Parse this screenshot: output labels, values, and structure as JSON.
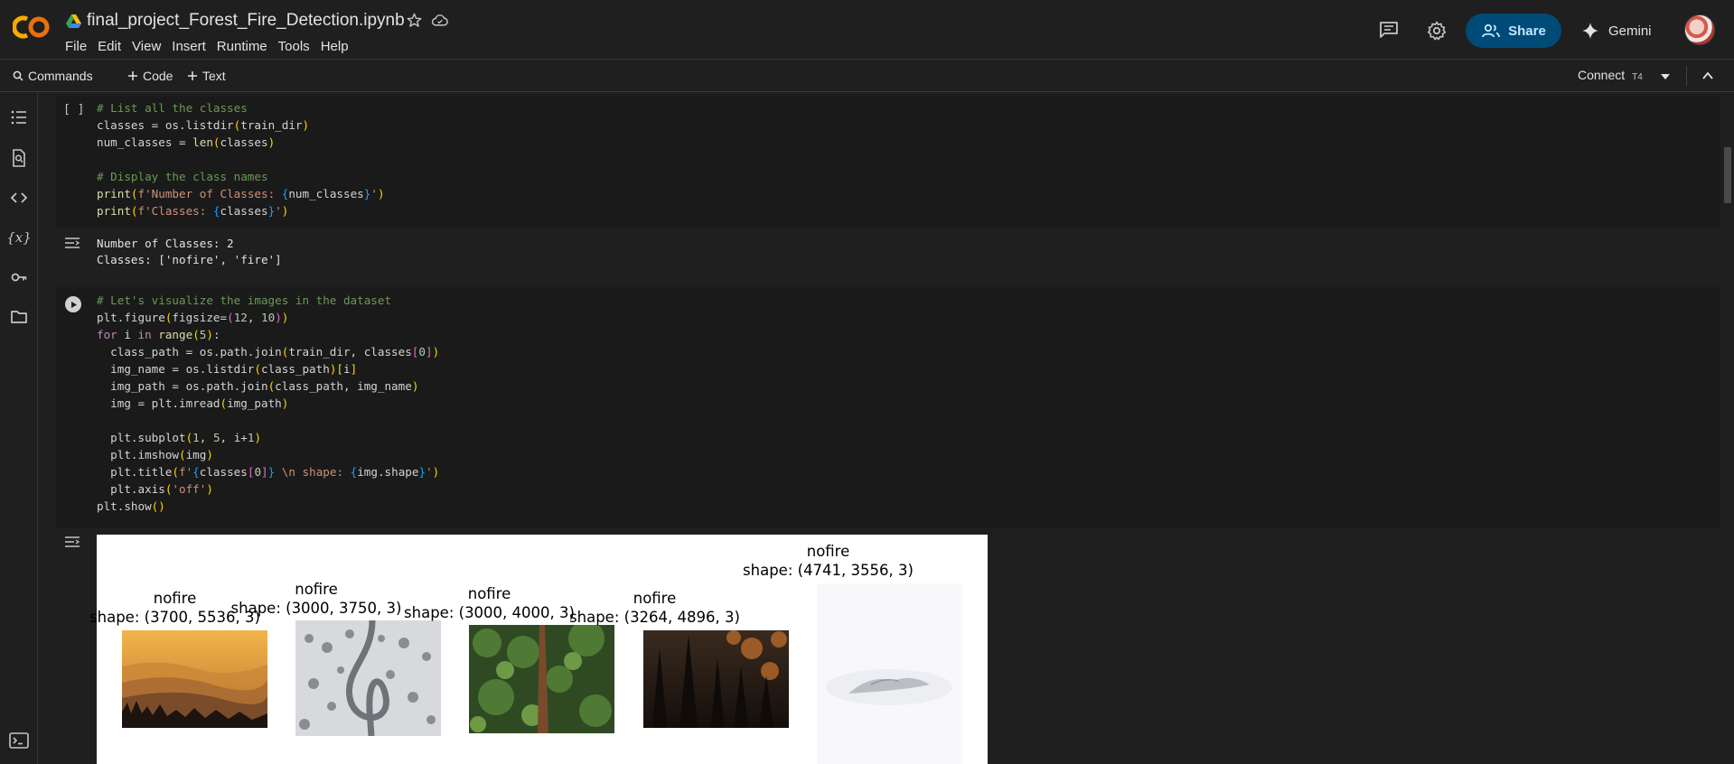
{
  "header": {
    "logo": "CO",
    "title": "final_project_Forest_Fire_Detection.ipynb",
    "icons": [
      "google-drive-icon",
      "star-icon",
      "cloud-sync-icon",
      "comment-icon",
      "gear-icon"
    ],
    "share_label": "Share",
    "gemini_label": "Gemini"
  },
  "menu": [
    "File",
    "Edit",
    "View",
    "Insert",
    "Runtime",
    "Tools",
    "Help"
  ],
  "toolbar": {
    "commands": "Commands",
    "add_code": "Code",
    "add_text": "Text",
    "connect": "Connect",
    "gpu": "T4"
  },
  "rail": [
    "table-of-contents-icon",
    "find-replace-icon",
    "code-snippets-icon",
    "variables-icon",
    "secrets-key-icon",
    "files-folder-icon",
    "terminal-icon"
  ],
  "cell1": {
    "bracket": "[ ]",
    "lines": [
      "# List all the classes",
      "classes = os.listdir(train_dir)",
      "num_classes = len(classes)",
      "",
      "# Display the class names",
      "print(f'Number of Classes: {num_classes}')",
      "print(f'Classes: {classes}')"
    ],
    "output": [
      "Number of Classes: 2",
      "Classes: ['nofire', 'fire']"
    ]
  },
  "cell2": {
    "lines": [
      "# Let's visualize the images in the dataset",
      "plt.figure(figsize=(12, 10))",
      "for i in range(5):",
      "  class_path = os.path.join(train_dir, classes[0])",
      "  img_name = os.listdir(class_path)[i]",
      "  img_path = os.path.join(class_path, img_name)",
      "  img = plt.imread(img_path)",
      "",
      "  plt.subplot(1, 5, i+1)",
      "  plt.imshow(img)",
      "  plt.title(f'{classes[0]} \\n shape: {img.shape}')",
      "  plt.axis('off')",
      "plt.show()"
    ],
    "figure": [
      {
        "title": "nofire",
        "shape": "shape: (3700, 5536, 3)",
        "image": "golden-misty-mountains"
      },
      {
        "title": "nofire",
        "shape": "shape: (3000, 3750, 3)",
        "image": "snowy-forest-winding-road"
      },
      {
        "title": "nofire",
        "shape": "shape: (3000, 4000, 3)",
        "image": "green-forest-canopy"
      },
      {
        "title": "nofire",
        "shape": "shape: (3264, 4896, 3)",
        "image": "dark-autumn-forest"
      },
      {
        "title": "nofire",
        "shape": "shape: (4741, 3556, 3)",
        "image": "foggy-white-hill"
      }
    ]
  }
}
